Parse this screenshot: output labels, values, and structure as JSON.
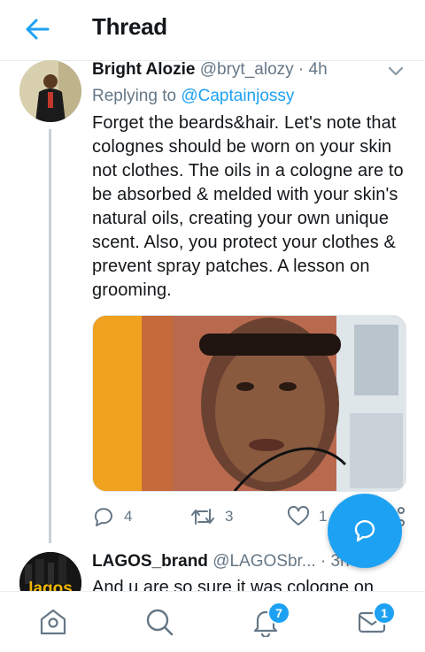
{
  "header": {
    "title": "Thread",
    "back_icon": "arrow-left-icon"
  },
  "tweet": {
    "name": "Bright Alozie",
    "handle": "@bryt_alozy",
    "separator": "·",
    "time": "4h",
    "replying_prefix": "Replying to",
    "replying_to": "@Captainjossy",
    "text": "Forget the beards&hair. Let's note that colognes should be worn on your skin not clothes. The oils in a cologne are to be absorbed & melded with your skin's natural oils, creating your own unique scent. Also, you protect your clothes & prevent spray patches. A lesson on grooming.",
    "replies": "4",
    "retweets": "3",
    "likes": "1"
  },
  "next_tweet": {
    "name": "LAGOS_brand",
    "handle": "@LAGOSbr...",
    "separator": "·",
    "time": "3h",
    "text_preview": "And u are so sure it was cologne on",
    "avatar_text": "lagos"
  },
  "tabbar": {
    "notifications_badge": "7",
    "messages_badge": "1"
  },
  "colors": {
    "accent": "#1da1f2",
    "secondary_text": "#657786",
    "divider": "#e6ecf0"
  }
}
